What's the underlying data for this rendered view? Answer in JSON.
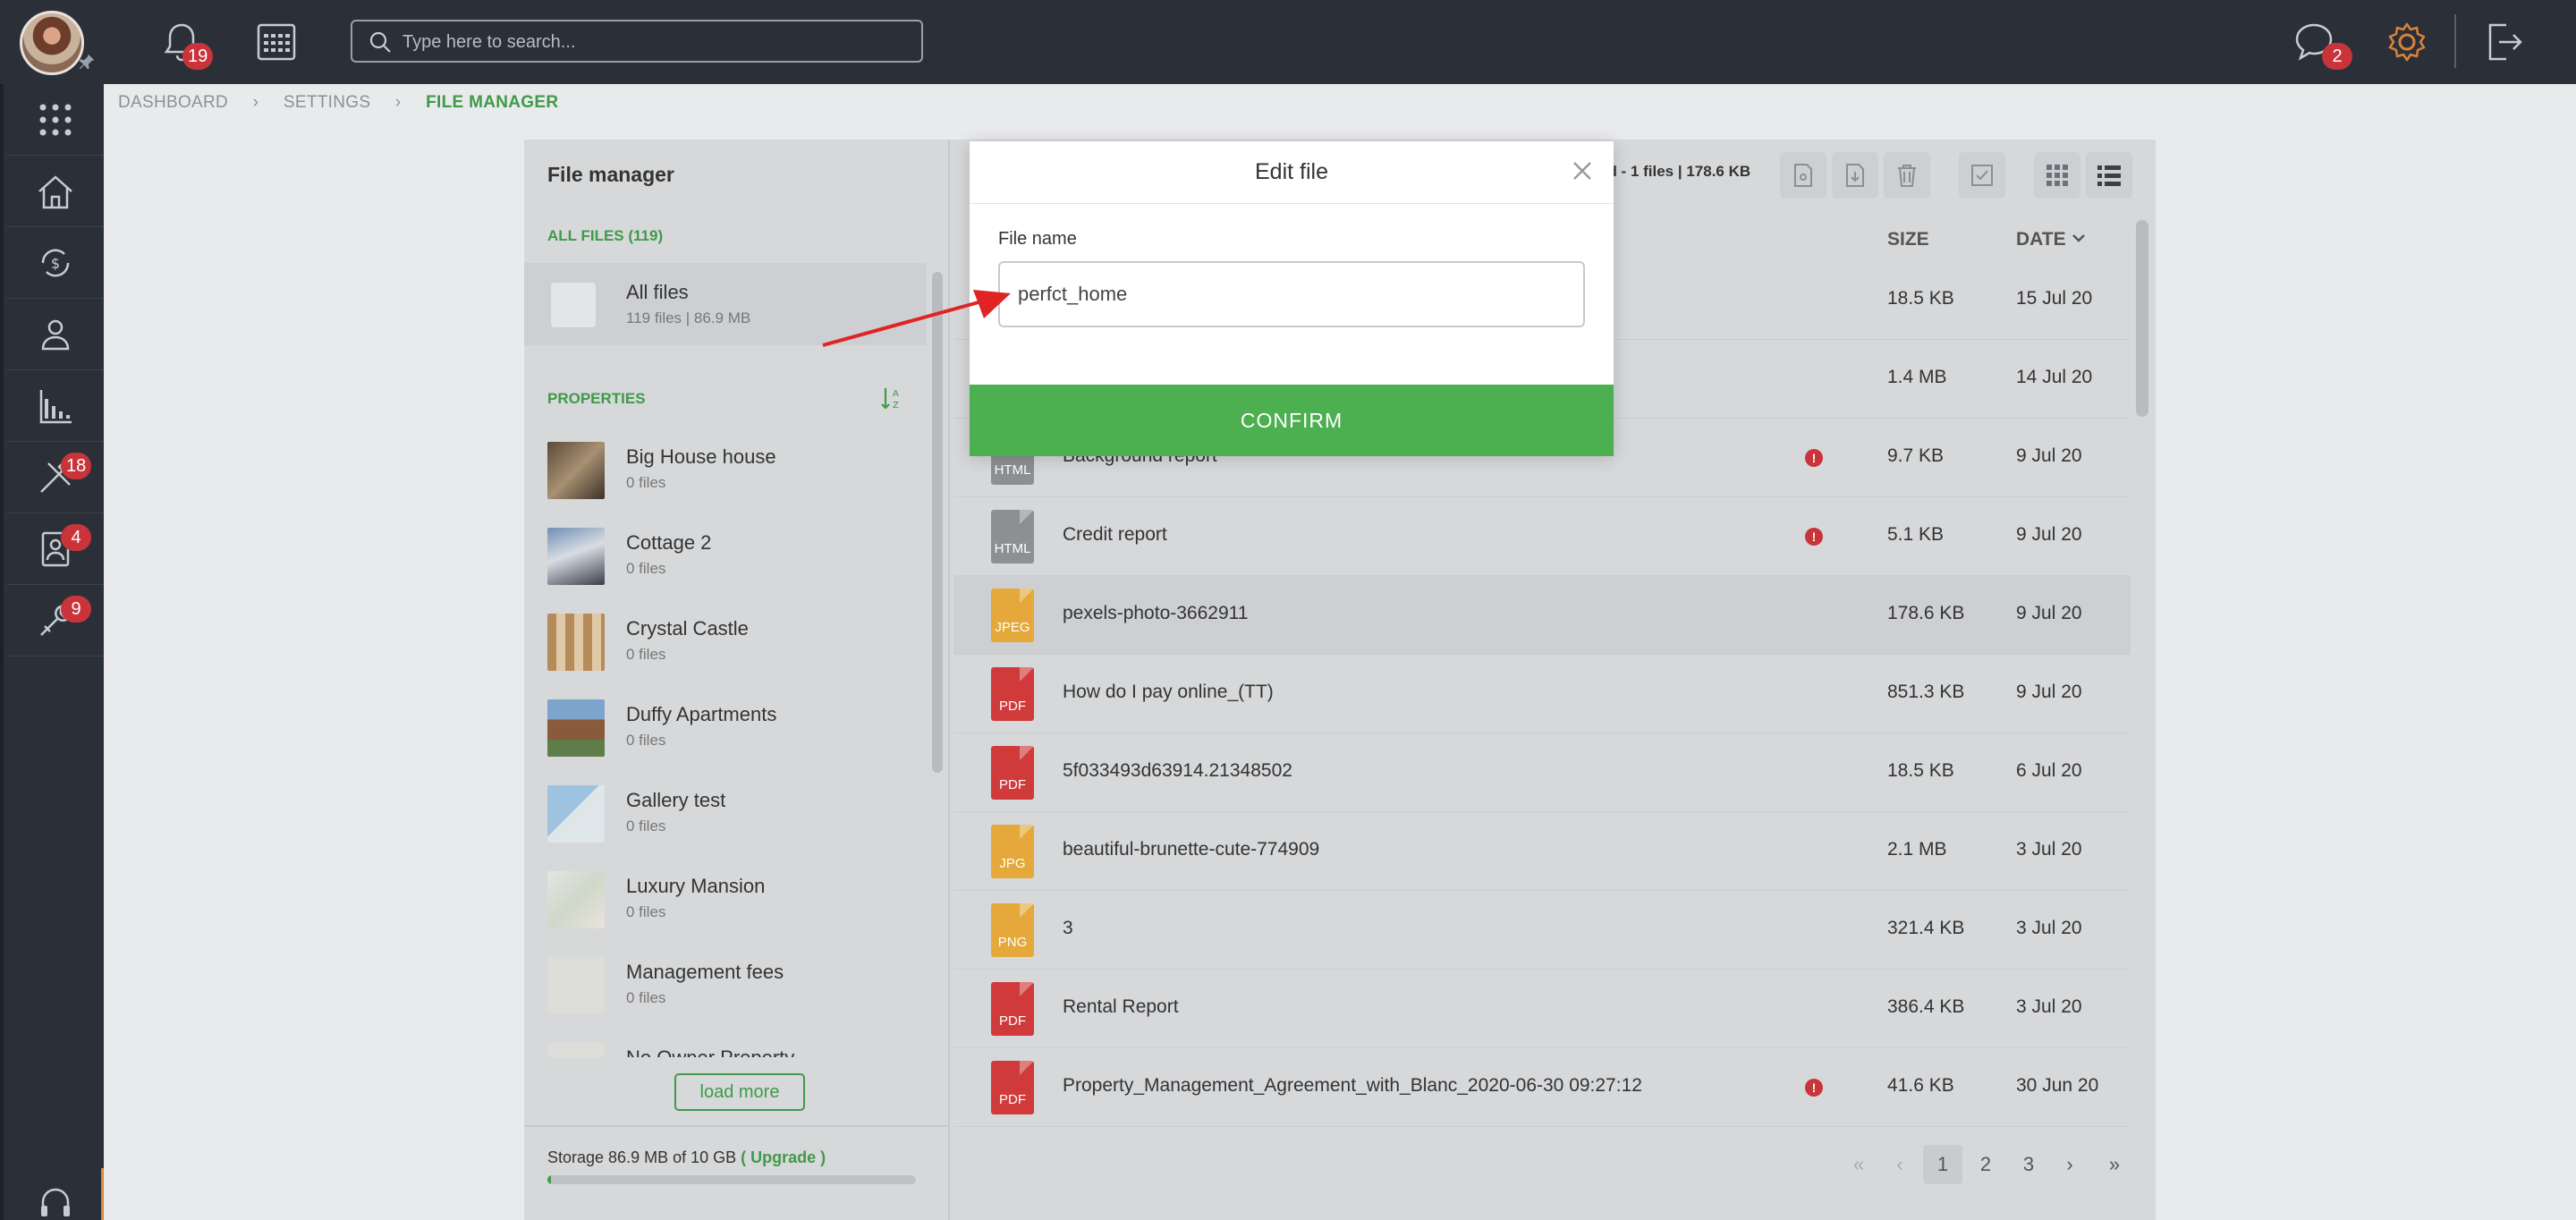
{
  "topbar": {
    "notifications_count": "19",
    "search_placeholder": "Type here to search...",
    "messages_count": "2"
  },
  "sidebar": {
    "items": [
      {
        "icon": "apps-grid-icon"
      },
      {
        "icon": "house-icon"
      },
      {
        "icon": "money-cycle-icon"
      },
      {
        "icon": "users-icon"
      },
      {
        "icon": "bar-chart-icon"
      },
      {
        "icon": "tools-icon",
        "badge": "18"
      },
      {
        "icon": "contact-card-icon",
        "badge": "4"
      },
      {
        "icon": "wrench-key-icon",
        "badge": "9"
      }
    ]
  },
  "breadcrumb": {
    "items": [
      "DASHBOARD",
      "SETTINGS",
      "FILE MANAGER"
    ]
  },
  "file_manager": {
    "title": "File manager",
    "all_files_header": "ALL FILES (119)",
    "all_files": {
      "name": "All files",
      "meta": "119 files | 86.9 MB"
    },
    "properties_header": "PROPERTIES",
    "properties": [
      {
        "name": "Big House house",
        "meta": "0 files"
      },
      {
        "name": "Cottage 2",
        "meta": "0 files"
      },
      {
        "name": "Crystal Castle",
        "meta": "0 files"
      },
      {
        "name": "Duffy Apartments",
        "meta": "0 files"
      },
      {
        "name": "Gallery test",
        "meta": "0 files"
      },
      {
        "name": "Luxury Mansion",
        "meta": "0 files"
      },
      {
        "name": "Management fees",
        "meta": "0 files"
      },
      {
        "name": "No Owner Property",
        "meta": ""
      }
    ],
    "load_more": "load more",
    "storage_text": "Storage 86.9 MB of 10 GB",
    "upgrade": "( Upgrade )",
    "storage_fraction": 0.0087
  },
  "toolbar": {
    "selection_info": "ed - 1 files | 178.6 KB"
  },
  "columns": {
    "size": "SIZE",
    "date": "DATE"
  },
  "files": [
    {
      "type": "",
      "name": "",
      "size": "18.5 KB",
      "date": "15 Jul 20",
      "warn": false
    },
    {
      "type": "",
      "name": "",
      "size": "1.4 MB",
      "date": "14 Jul 20",
      "warn": false
    },
    {
      "type": "HTML",
      "name": "Background report",
      "size": "9.7 KB",
      "date": "9 Jul 20",
      "warn": true
    },
    {
      "type": "HTML",
      "name": "Credit report",
      "size": "5.1 KB",
      "date": "9 Jul 20",
      "warn": true
    },
    {
      "type": "JPEG",
      "name": "pexels-photo-3662911",
      "size": "178.6 KB",
      "date": "9 Jul 20",
      "warn": false
    },
    {
      "type": "PDF",
      "name": "How do I pay online_(TT)",
      "size": "851.3 KB",
      "date": "9 Jul 20",
      "warn": false
    },
    {
      "type": "PDF",
      "name": "5f033493d63914.21348502",
      "size": "18.5 KB",
      "date": "6 Jul 20",
      "warn": false
    },
    {
      "type": "JPG",
      "name": "beautiful-brunette-cute-774909",
      "size": "2.1 MB",
      "date": "3 Jul 20",
      "warn": false
    },
    {
      "type": "PNG",
      "name": "3",
      "size": "321.4 KB",
      "date": "3 Jul 20",
      "warn": false
    },
    {
      "type": "PDF",
      "name": "Rental Report",
      "size": "386.4 KB",
      "date": "3 Jul 20",
      "warn": false
    },
    {
      "type": "PDF",
      "name": "Property_Management_Agreement_with_Blanc_2020-06-30 09:27:12",
      "size": "41.6 KB",
      "date": "30 Jun 20",
      "warn": true
    }
  ],
  "pagination": {
    "first": "«",
    "prev": "‹",
    "pages": [
      "1",
      "2",
      "3"
    ],
    "next": "›",
    "last": "»"
  },
  "modal": {
    "title": "Edit file",
    "field_label": "File name",
    "field_value": "perfct_home",
    "confirm": "CONFIRM"
  },
  "colors": {
    "accent_green": "#4caf50",
    "badge_red": "#c8343a",
    "topbar": "#2b3038",
    "pdf_red": "#d03a3a",
    "html_gray": "#8d8f93",
    "img_orange": "#e4a93a"
  }
}
